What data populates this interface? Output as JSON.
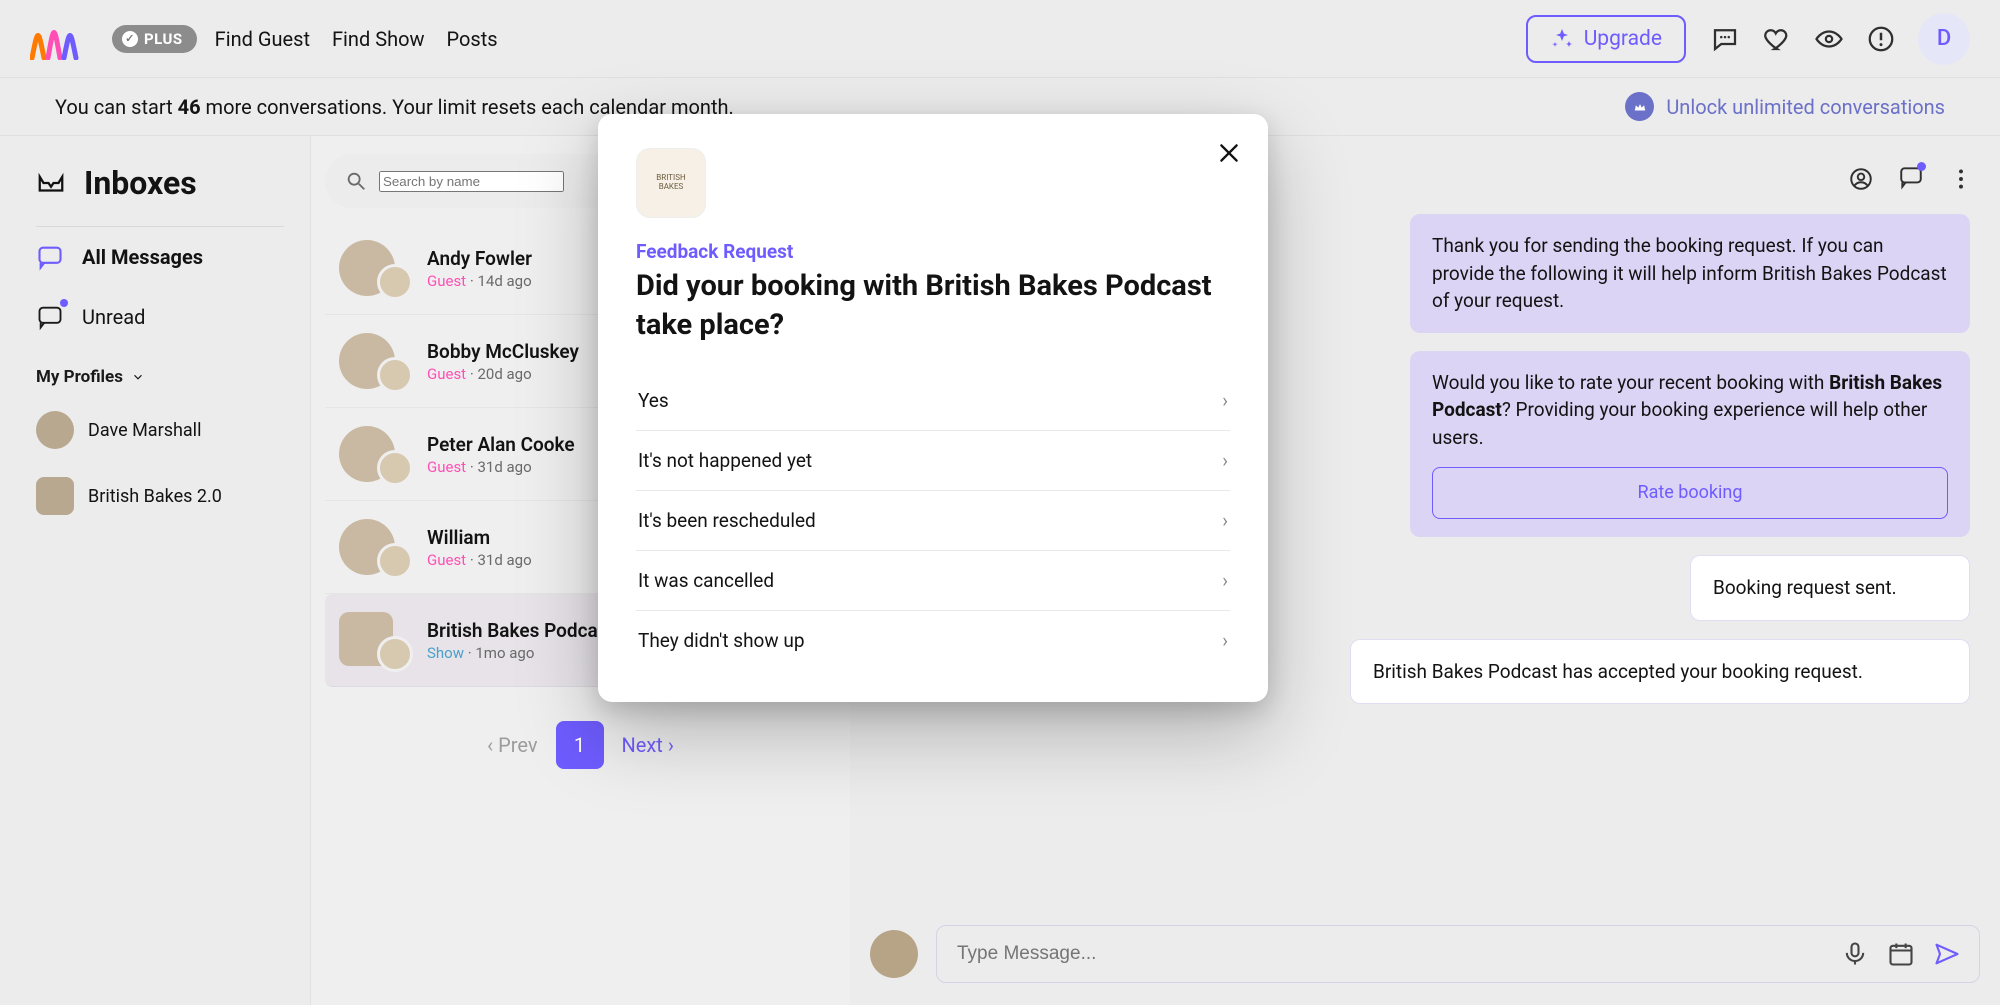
{
  "header": {
    "plus_badge": "PLUS",
    "nav": {
      "find_guest": "Find Guest",
      "find_show": "Find Show",
      "posts": "Posts"
    },
    "upgrade": "Upgrade",
    "avatar_initial": "D"
  },
  "banner": {
    "prefix": "You can start ",
    "count": "46",
    "suffix": " more conversations. Your limit resets each calendar month.",
    "unlock": "Unlock unlimited conversations"
  },
  "sidebar": {
    "title": "Inboxes",
    "all": "All Messages",
    "unread": "Unread",
    "section": "My Profiles",
    "profiles": {
      "p1": "Dave Marshall",
      "p2": "British Bakes 2.0"
    }
  },
  "search": {
    "placeholder": "Search by name"
  },
  "conversations": {
    "items": [
      {
        "name": "Andy Fowler",
        "role": "Guest",
        "time": "14d ago"
      },
      {
        "name": "Bobby McCluskey",
        "role": "Guest",
        "time": "20d ago"
      },
      {
        "name": "Peter Alan Cooke",
        "role": "Guest",
        "time": "31d ago"
      },
      {
        "name": "William",
        "role": "Guest",
        "time": "31d ago"
      },
      {
        "name": "British Bakes Podcast",
        "role": "Show",
        "time": "1mo ago"
      }
    ]
  },
  "pager": {
    "prev": "‹ Prev",
    "page": "1",
    "next": "Next ›"
  },
  "chat": {
    "msg1": "Thank you for sending the booking request. If you can provide the following it will help inform British Bakes Podcast of your request.",
    "msg2_pre": "Would you like to rate your recent booking with ",
    "msg2_bold": "British Bakes Podcast",
    "msg2_post": "? Providing your booking experience will help other users.",
    "rate_btn": "Rate booking",
    "msg3": "Booking request sent.",
    "msg4": "British Bakes Podcast has accepted your booking request.",
    "composer_placeholder": "Type Message..."
  },
  "modal": {
    "eyebrow": "Feedback Request",
    "title": "Did your booking with British Bakes Podcast take place?",
    "options": {
      "o1": "Yes",
      "o2": "It's not happened yet",
      "o3": "It's been rescheduled",
      "o4": "It was cancelled",
      "o5": "They didn't show up"
    }
  }
}
